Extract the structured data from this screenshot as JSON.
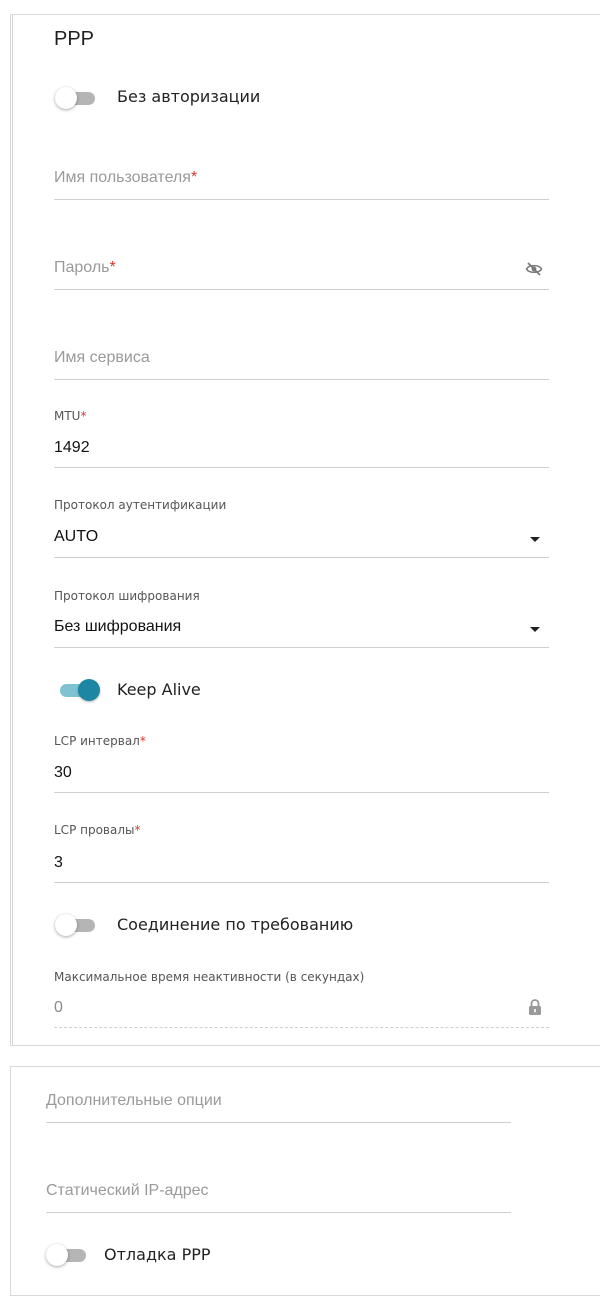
{
  "ppp": {
    "title": "PPP",
    "no_auth": {
      "label": "Без авторизации",
      "enabled": false
    },
    "username": {
      "placeholder": "Имя пользователя",
      "required_mark": "*",
      "value": ""
    },
    "password": {
      "placeholder": "Пароль",
      "required_mark": "*",
      "value": "",
      "toggle_icon": "eye-off-icon"
    },
    "service_name": {
      "placeholder": "Имя сервиса",
      "value": ""
    },
    "mtu": {
      "label": "MTU",
      "required_mark": "*",
      "value": "1492"
    },
    "auth_protocol": {
      "label": "Протокол аутентификации",
      "value": "AUTO",
      "icon": "chevron-down-icon"
    },
    "encryption_protocol": {
      "label": "Протокол шифрования",
      "value": "Без шифрования",
      "icon": "chevron-down-icon"
    },
    "keep_alive": {
      "label": "Keep Alive",
      "enabled": true,
      "accent_color": "#1c86a3"
    },
    "lcp_interval": {
      "label": "LCP интервал",
      "required_mark": "*",
      "value": "30"
    },
    "lcp_failures": {
      "label": "LCP провалы",
      "required_mark": "*",
      "value": "3"
    },
    "dial_on_demand": {
      "label": "Соединение по требованию",
      "enabled": false
    },
    "max_idle_time": {
      "label": "Максимальное время неактивности (в секундах)",
      "value": "0",
      "icon": "lock-icon"
    }
  },
  "extra": {
    "additional_options": {
      "placeholder": "Дополнительные опции",
      "value": ""
    },
    "static_ip": {
      "placeholder": "Статический IP-адрес",
      "value": ""
    },
    "ppp_debug": {
      "label": "Отладка PPP",
      "enabled": false
    }
  }
}
